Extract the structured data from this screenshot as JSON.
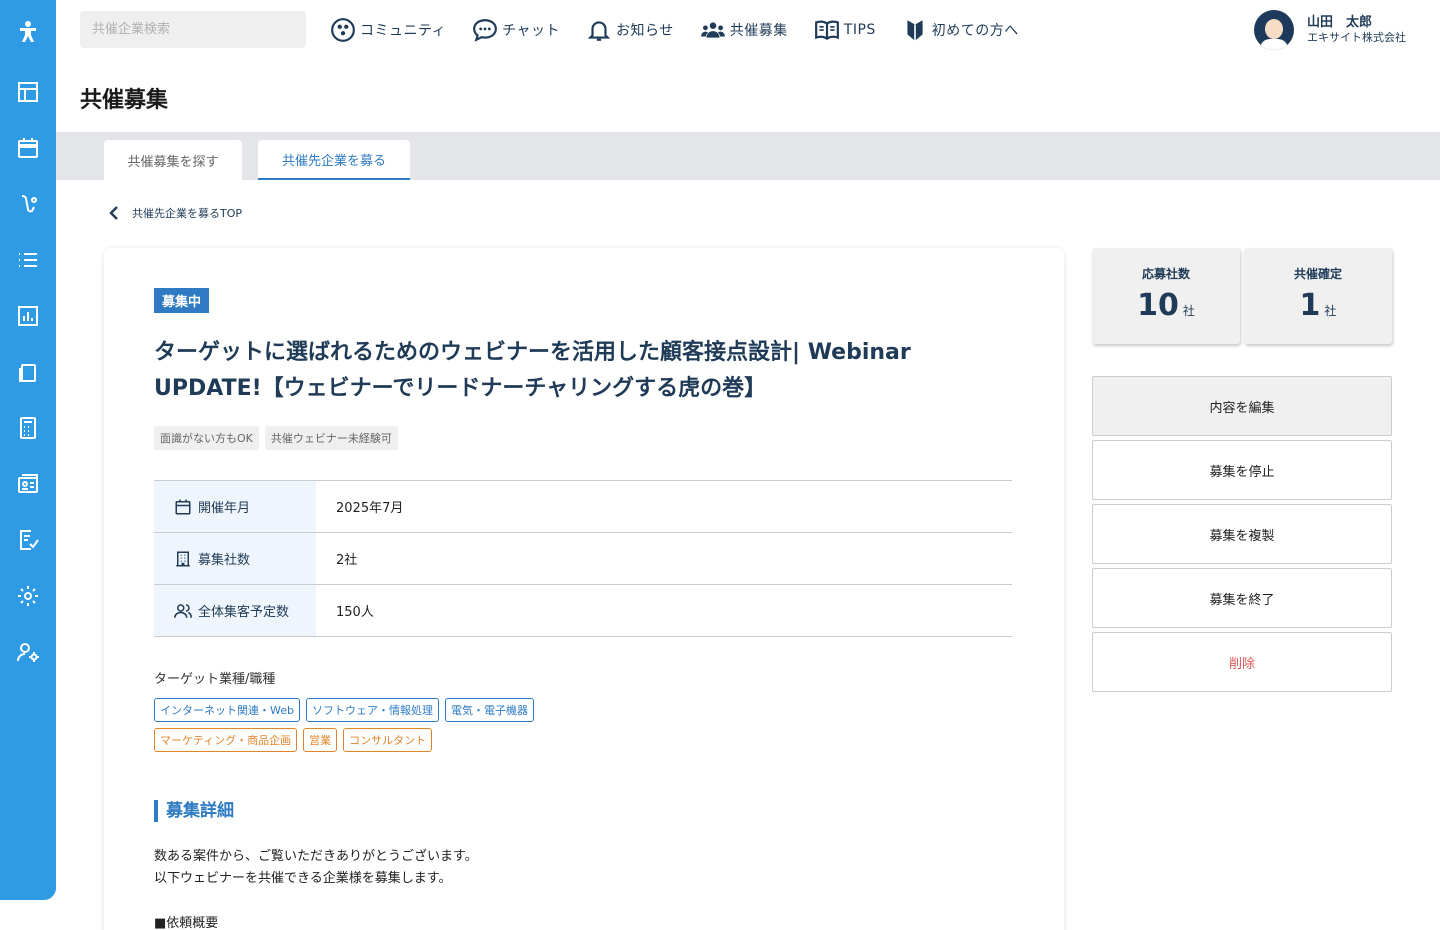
{
  "search": {
    "placeholder": "共催企業検索"
  },
  "nav": [
    {
      "label": "コミュニティ",
      "icon": "community-icon"
    },
    {
      "label": "チャット",
      "icon": "chat-icon"
    },
    {
      "label": "お知らせ",
      "icon": "bell-icon"
    },
    {
      "label": "共催募集",
      "icon": "people-icon"
    },
    {
      "label": "TIPS",
      "icon": "book-icon"
    },
    {
      "label": "初めての方へ",
      "icon": "beginner-icon"
    }
  ],
  "user": {
    "name": "山田　太郎",
    "company": "エキサイト株式会社"
  },
  "page_title": "共催募集",
  "tabs": [
    {
      "label": "共催募集を探す"
    },
    {
      "label": "共催先企業を募る"
    }
  ],
  "breadcrumb": {
    "back_label": "共催先企業を募るTOP"
  },
  "card": {
    "status": "募集中",
    "title": "ターゲットに選ばれるためのウェビナーを活用した顧客接点設計| Webinar UPDATE!【ウェビナーでリードナーチャリングする虎の巻】",
    "tags": [
      "面識がない方もOK",
      "共催ウェビナー未経験可"
    ],
    "info": [
      {
        "label": "開催年月",
        "value": "2025年7月",
        "icon": "calendar-icon"
      },
      {
        "label": "募集社数",
        "value": "2社",
        "icon": "building-icon"
      },
      {
        "label": "全体集客予定数",
        "value": "150人",
        "icon": "people-icon"
      }
    ],
    "target_label": "ターゲット業種/職種",
    "industries": [
      "インターネット関連・Web",
      "ソフトウェア・情報処理",
      "電気・電子機器"
    ],
    "jobs": [
      "マーケティング・商品企画",
      "営業",
      "コンサルタント"
    ],
    "detail_heading": "募集詳細",
    "detail_line1": "数ある案件から、ご覧いただきありがとうございます。",
    "detail_line2": "以下ウェビナーを共催できる企業様を募集します。",
    "detail_line3": "■依頼概要"
  },
  "stats": [
    {
      "label": "応募社数",
      "value": "10",
      "unit": "社"
    },
    {
      "label": "共催確定",
      "value": "1",
      "unit": "社"
    }
  ],
  "actions": {
    "edit": "内容を編集",
    "stop": "募集を停止",
    "duplicate": "募集を複製",
    "end": "募集を終了",
    "delete": "削除"
  },
  "colors": {
    "sidebar": "#2e9be4",
    "accent": "#2e7bc4",
    "orange": "#e0842c",
    "danger": "#e05555",
    "navy": "#1f3b57"
  }
}
